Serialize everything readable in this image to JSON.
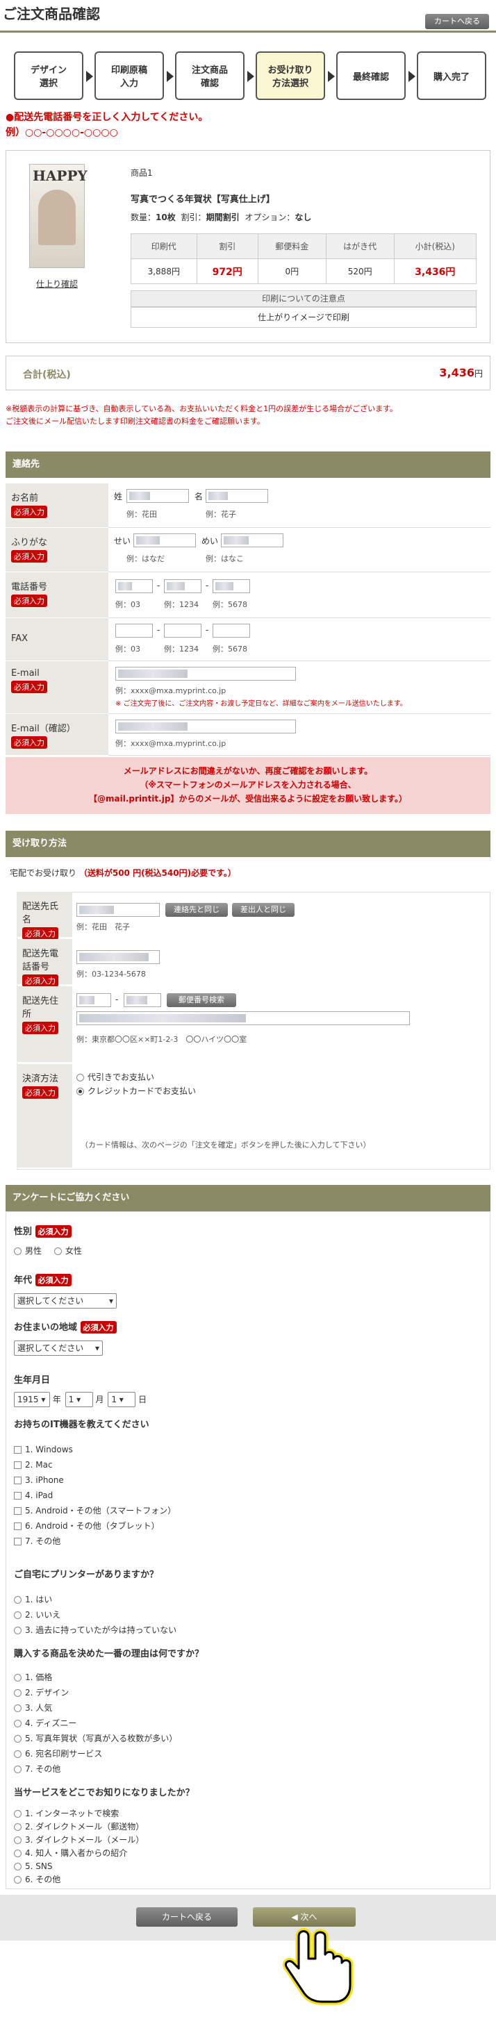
{
  "header": {
    "title": "ご注文商品確認",
    "cart_button": "カートへ戻る"
  },
  "steps": [
    {
      "l1": "デザイン",
      "l2": "選択"
    },
    {
      "l1": "印刷原稿",
      "l2": "入力"
    },
    {
      "l1": "注文商品",
      "l2": "確認"
    },
    {
      "l1": "お受け取り",
      "l2": "方法選択"
    },
    {
      "l1": "最終確認",
      "l2": ""
    },
    {
      "l1": "購入完了",
      "l2": ""
    }
  ],
  "error": {
    "line1": "●配送先電話番号を正しく入力してください。",
    "line2": "例）○○-○○○○-○○○○"
  },
  "product": {
    "thumb_text": "HAPPY",
    "finish_link": "仕上り確認",
    "name": "商品1",
    "title": "写真でつくる年賀状【写真仕上げ】",
    "qty_label": "数量：",
    "qty": "10枚",
    "disc_label": "割引：",
    "disc": "期間割引",
    "opt_label": "オプション：",
    "opt": "なし",
    "table_head": [
      "印刷代",
      "割引",
      "郵便料金",
      "はがき代",
      "小計(税込)"
    ],
    "table_vals": [
      "3,888円",
      "972円",
      "0円",
      "520円",
      "3,436円"
    ],
    "note_head": "印刷についての注意点",
    "note_text": "仕上がりイメージで印刷"
  },
  "total": {
    "label": "合計(税込)",
    "value": "3,436",
    "unit": "円"
  },
  "notice": [
    "※税額表示の計算に基づき、自動表示している為、お支払いいただく料金と1円の誤差が生じる場合がございます。",
    "ご注文後にメール配信いたします印刷注文確認書の料金をご確認願います。"
  ],
  "contact": {
    "heading": "連絡先",
    "required": "必須入力",
    "name_label": "お名前",
    "sei": "姓",
    "mei": "名",
    "name_ex1": "例：花田",
    "name_ex2": "例：花子",
    "kana_label": "ふりがな",
    "kana_sei": "せい",
    "kana_mei": "めい",
    "kana_ex1": "例：はなだ",
    "kana_ex2": "例：はなこ",
    "tel_label": "電話番号",
    "tel_ex1": "例：03",
    "tel_ex2": "例：1234",
    "tel_ex3": "例：5678",
    "fax_label": "FAX",
    "fax_ex1": "例：03",
    "fax_ex2": "例：1234",
    "fax_ex3": "例：5678",
    "email_label": "E-mail",
    "email_ex": "例：xxxx@mxa.myprint.co.jp",
    "email_note": "※ ご注文完了後に、ご注文内容・お渡し予定日など、詳細なご案内をメール送信いたします。",
    "email2_label": "E-mail（確認）",
    "email2_ex": "例：xxxx@mxa.myprint.co.jp",
    "warn1": "メールアドレスにお間違えがないか、再度ご確認をお願いします。",
    "warn2": "（※スマートフォンのメールアドレスを入力される場合、",
    "warn3": "【@mail.printit.jp】からのメールが、受信出来るように設定をお願い致します。）"
  },
  "pickup": {
    "heading": "受け取り方法",
    "method": "宅配でお受け取り",
    "fee": "（送料が500 円(税込540円)必要です。）",
    "name_label": "配送先氏名",
    "same_contact": "連絡先と同じ",
    "same_sender": "差出人と同じ",
    "name_ex": "例：花田　花子",
    "tel_label": "配送先電話番号",
    "tel_ex": "例：03-1234-5678",
    "addr_label": "配送先住所",
    "zip_search": "郵便番号検索",
    "addr_ex": "例：東京都〇〇区××町1-2-3　〇〇ハイツ〇〇室",
    "pay_label": "決済方法",
    "pay_opt1": "代引きでお支払い",
    "pay_opt2": "クレジットカードでお支払い",
    "pay_note": "（カード情報は、次のページの「注文を確定」ボタンを押した後に入力して下さい）"
  },
  "survey": {
    "heading": "アンケートにご協力ください",
    "gender_label": "性別",
    "gender_opts": [
      "男性",
      "女性"
    ],
    "age_label": "年代",
    "select_placeholder": "選択してください",
    "region_label": "お住まいの地域",
    "birth_label": "生年月日",
    "birth_year": "1915",
    "year_unit": "年",
    "birth_month": "1",
    "month_unit": "月",
    "birth_day": "1",
    "day_unit": "日",
    "q1": "お持ちのIT機器を教えてください",
    "q1_opts": [
      "1. Windows",
      "2. Mac",
      "3. iPhone",
      "4. iPad",
      "5. Android・その他（スマートフォン）",
      "6. Android・その他（タブレット）",
      "7. その他"
    ],
    "q2": "ご自宅にプリンターがありますか？",
    "q2_opts": [
      "1. はい",
      "2. いいえ",
      "3. 過去に持っていたが今は持っていない"
    ],
    "q3": "購入する商品を決めた一番の理由は何ですか？",
    "q3_opts": [
      "1. 価格",
      "2. デザイン",
      "3. 人気",
      "4. ディズニー",
      "5. 写真年賀状（写真が入る枚数が多い）",
      "6. 宛名印刷サービス",
      "7. その他"
    ],
    "q4": "当サービスをどこでお知りになりましたか？",
    "q4_opts": [
      "1. インターネットで検索",
      "2. ダイレクトメール（郵送物）",
      "3. ダイレクトメール（メール）",
      "4. 知人・購入者からの紹介",
      "5. SNS",
      "6. その他"
    ]
  },
  "footer": {
    "back": "カートへ戻る",
    "next": "次へ"
  },
  "colors": {
    "accent": "#8b8a66",
    "error": "#d40000",
    "label_bg": "#eae8e2",
    "current_step": "#fbf6d2"
  }
}
